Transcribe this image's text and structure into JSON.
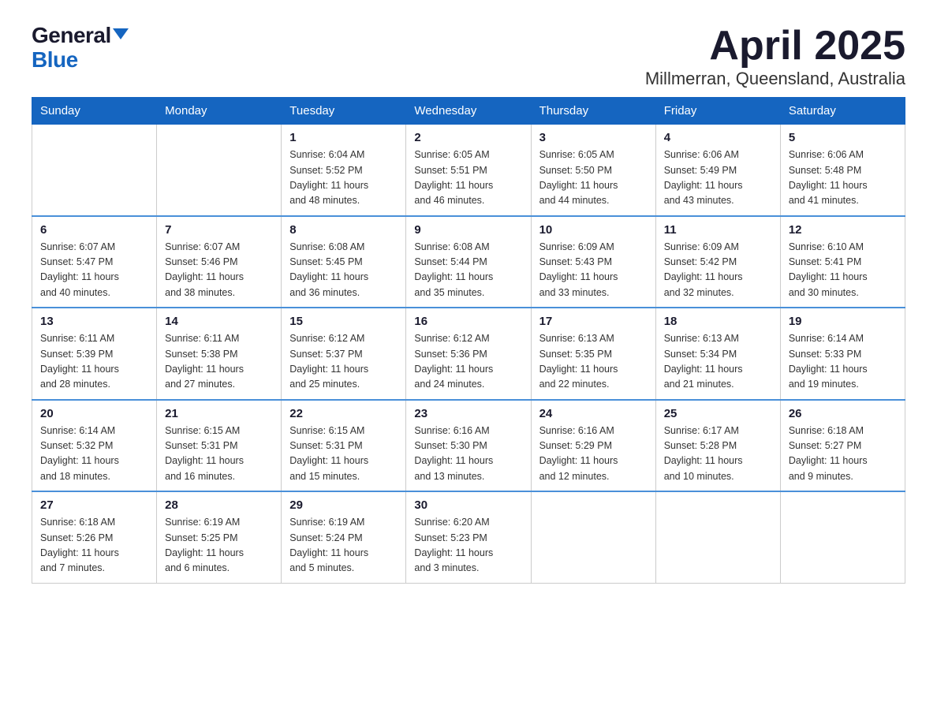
{
  "logo": {
    "general": "General",
    "blue": "Blue"
  },
  "title": "April 2025",
  "location": "Millmerran, Queensland, Australia",
  "weekdays": [
    "Sunday",
    "Monday",
    "Tuesday",
    "Wednesday",
    "Thursday",
    "Friday",
    "Saturday"
  ],
  "weeks": [
    [
      {
        "day": "",
        "info": ""
      },
      {
        "day": "",
        "info": ""
      },
      {
        "day": "1",
        "info": "Sunrise: 6:04 AM\nSunset: 5:52 PM\nDaylight: 11 hours\nand 48 minutes."
      },
      {
        "day": "2",
        "info": "Sunrise: 6:05 AM\nSunset: 5:51 PM\nDaylight: 11 hours\nand 46 minutes."
      },
      {
        "day": "3",
        "info": "Sunrise: 6:05 AM\nSunset: 5:50 PM\nDaylight: 11 hours\nand 44 minutes."
      },
      {
        "day": "4",
        "info": "Sunrise: 6:06 AM\nSunset: 5:49 PM\nDaylight: 11 hours\nand 43 minutes."
      },
      {
        "day": "5",
        "info": "Sunrise: 6:06 AM\nSunset: 5:48 PM\nDaylight: 11 hours\nand 41 minutes."
      }
    ],
    [
      {
        "day": "6",
        "info": "Sunrise: 6:07 AM\nSunset: 5:47 PM\nDaylight: 11 hours\nand 40 minutes."
      },
      {
        "day": "7",
        "info": "Sunrise: 6:07 AM\nSunset: 5:46 PM\nDaylight: 11 hours\nand 38 minutes."
      },
      {
        "day": "8",
        "info": "Sunrise: 6:08 AM\nSunset: 5:45 PM\nDaylight: 11 hours\nand 36 minutes."
      },
      {
        "day": "9",
        "info": "Sunrise: 6:08 AM\nSunset: 5:44 PM\nDaylight: 11 hours\nand 35 minutes."
      },
      {
        "day": "10",
        "info": "Sunrise: 6:09 AM\nSunset: 5:43 PM\nDaylight: 11 hours\nand 33 minutes."
      },
      {
        "day": "11",
        "info": "Sunrise: 6:09 AM\nSunset: 5:42 PM\nDaylight: 11 hours\nand 32 minutes."
      },
      {
        "day": "12",
        "info": "Sunrise: 6:10 AM\nSunset: 5:41 PM\nDaylight: 11 hours\nand 30 minutes."
      }
    ],
    [
      {
        "day": "13",
        "info": "Sunrise: 6:11 AM\nSunset: 5:39 PM\nDaylight: 11 hours\nand 28 minutes."
      },
      {
        "day": "14",
        "info": "Sunrise: 6:11 AM\nSunset: 5:38 PM\nDaylight: 11 hours\nand 27 minutes."
      },
      {
        "day": "15",
        "info": "Sunrise: 6:12 AM\nSunset: 5:37 PM\nDaylight: 11 hours\nand 25 minutes."
      },
      {
        "day": "16",
        "info": "Sunrise: 6:12 AM\nSunset: 5:36 PM\nDaylight: 11 hours\nand 24 minutes."
      },
      {
        "day": "17",
        "info": "Sunrise: 6:13 AM\nSunset: 5:35 PM\nDaylight: 11 hours\nand 22 minutes."
      },
      {
        "day": "18",
        "info": "Sunrise: 6:13 AM\nSunset: 5:34 PM\nDaylight: 11 hours\nand 21 minutes."
      },
      {
        "day": "19",
        "info": "Sunrise: 6:14 AM\nSunset: 5:33 PM\nDaylight: 11 hours\nand 19 minutes."
      }
    ],
    [
      {
        "day": "20",
        "info": "Sunrise: 6:14 AM\nSunset: 5:32 PM\nDaylight: 11 hours\nand 18 minutes."
      },
      {
        "day": "21",
        "info": "Sunrise: 6:15 AM\nSunset: 5:31 PM\nDaylight: 11 hours\nand 16 minutes."
      },
      {
        "day": "22",
        "info": "Sunrise: 6:15 AM\nSunset: 5:31 PM\nDaylight: 11 hours\nand 15 minutes."
      },
      {
        "day": "23",
        "info": "Sunrise: 6:16 AM\nSunset: 5:30 PM\nDaylight: 11 hours\nand 13 minutes."
      },
      {
        "day": "24",
        "info": "Sunrise: 6:16 AM\nSunset: 5:29 PM\nDaylight: 11 hours\nand 12 minutes."
      },
      {
        "day": "25",
        "info": "Sunrise: 6:17 AM\nSunset: 5:28 PM\nDaylight: 11 hours\nand 10 minutes."
      },
      {
        "day": "26",
        "info": "Sunrise: 6:18 AM\nSunset: 5:27 PM\nDaylight: 11 hours\nand 9 minutes."
      }
    ],
    [
      {
        "day": "27",
        "info": "Sunrise: 6:18 AM\nSunset: 5:26 PM\nDaylight: 11 hours\nand 7 minutes."
      },
      {
        "day": "28",
        "info": "Sunrise: 6:19 AM\nSunset: 5:25 PM\nDaylight: 11 hours\nand 6 minutes."
      },
      {
        "day": "29",
        "info": "Sunrise: 6:19 AM\nSunset: 5:24 PM\nDaylight: 11 hours\nand 5 minutes."
      },
      {
        "day": "30",
        "info": "Sunrise: 6:20 AM\nSunset: 5:23 PM\nDaylight: 11 hours\nand 3 minutes."
      },
      {
        "day": "",
        "info": ""
      },
      {
        "day": "",
        "info": ""
      },
      {
        "day": "",
        "info": ""
      }
    ]
  ]
}
